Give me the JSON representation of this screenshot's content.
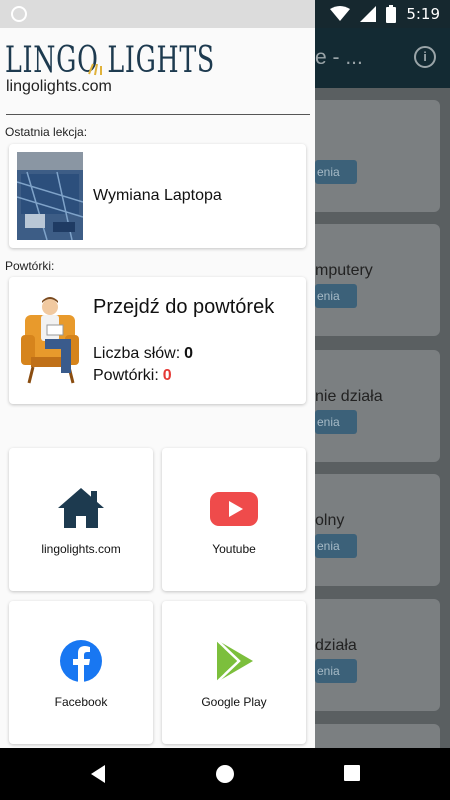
{
  "status_bar": {
    "time": "5:19"
  },
  "background_app": {
    "title": "e - ...",
    "cards": [
      {
        "text": "",
        "badge": "enia"
      },
      {
        "text": "mputery",
        "badge": "enia"
      },
      {
        "text": "nie działa",
        "badge": "enia"
      },
      {
        "text": "olny",
        "badge": "enia"
      },
      {
        "text": "działa",
        "badge": "enia"
      }
    ]
  },
  "drawer": {
    "brand": {
      "logo_text": "LINGO LIGHTS",
      "url": "lingolights.com"
    },
    "last_lesson": {
      "section_label": "Ostatnia lekcja:",
      "title": "Wymiana Laptopa"
    },
    "reviews": {
      "section_label": "Powtórki:",
      "title": "Przejdź do powtórek",
      "word_count_label": "Liczba słów:",
      "word_count": "0",
      "reviews_label": "Powtórki:",
      "reviews_count": "0"
    },
    "links": [
      {
        "label": "lingolights.com",
        "icon": "home-icon"
      },
      {
        "label": "Youtube",
        "icon": "youtube-icon"
      },
      {
        "label": "Facebook",
        "icon": "facebook-icon"
      },
      {
        "label": "Google Play",
        "icon": "google-play-icon"
      }
    ]
  },
  "colors": {
    "brand_navy": "#1d3a4f",
    "youtube_red": "#ef4b4b",
    "facebook_blue": "#1877f2",
    "play_green": "#7cbf3c",
    "review_count_red": "#e53935"
  }
}
